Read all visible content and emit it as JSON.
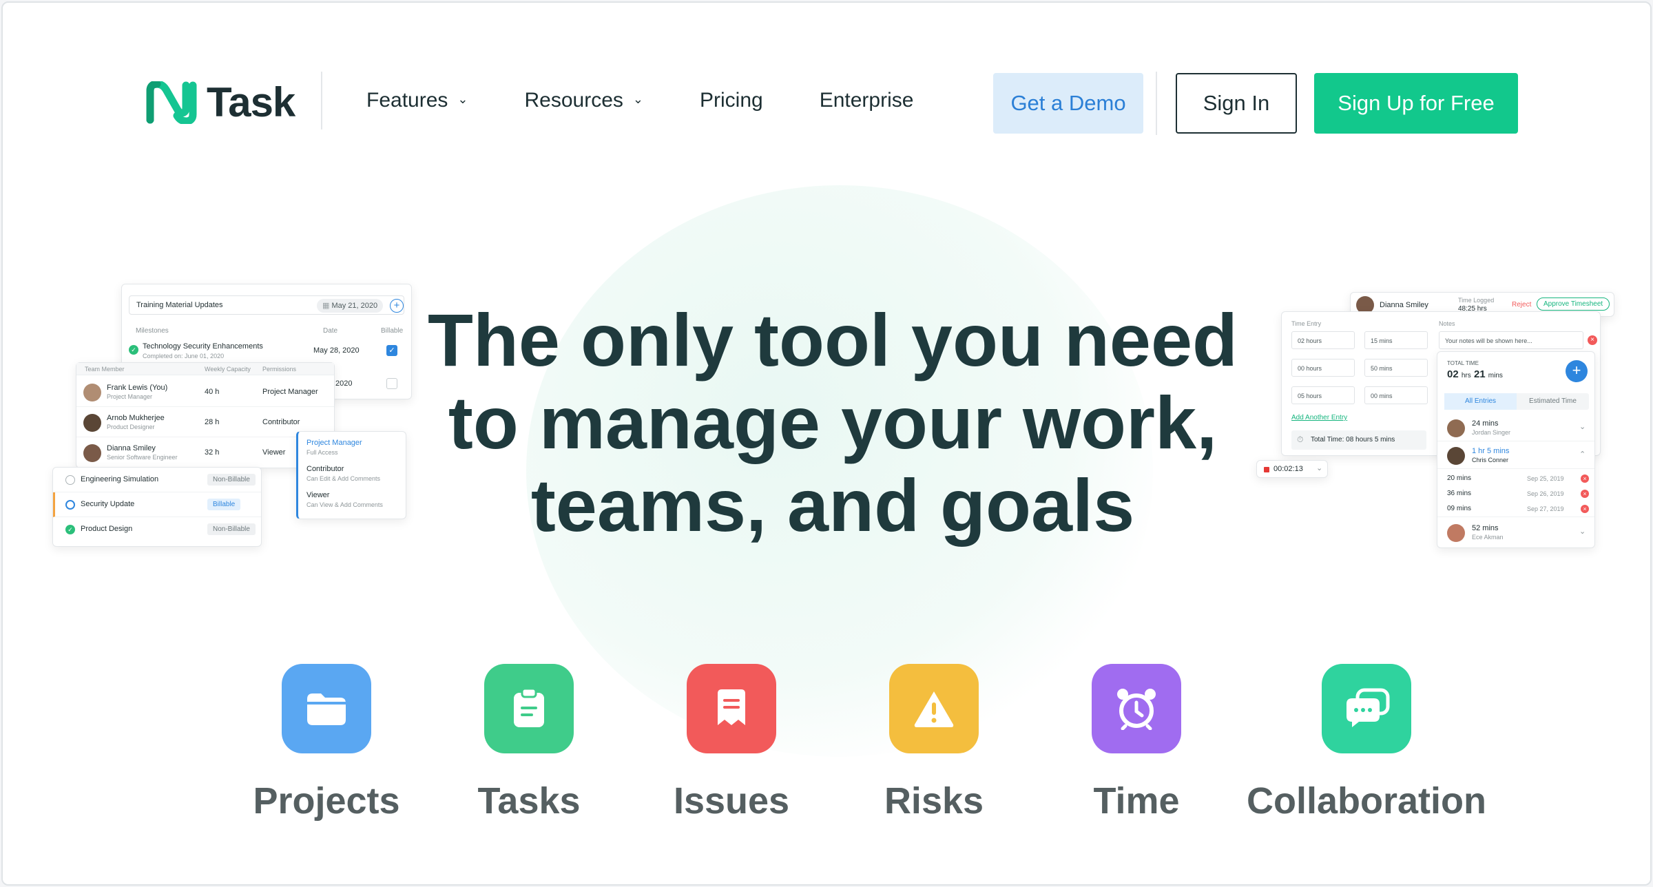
{
  "nav": {
    "logo_text": "Task",
    "items": [
      {
        "label": "Features",
        "has_dropdown": true
      },
      {
        "label": "Resources",
        "has_dropdown": true
      },
      {
        "label": "Pricing",
        "has_dropdown": false
      },
      {
        "label": "Enterprise",
        "has_dropdown": false
      }
    ],
    "demo_label": "Get a Demo",
    "signin_label": "Sign In",
    "signup_label": "Sign Up for Free"
  },
  "hero": {
    "line1": "The only tool you need",
    "line2": "to manage your work,",
    "line3": "teams, and goals"
  },
  "features": [
    {
      "label": "Projects",
      "color": "#5aa7f2",
      "icon": "folder-icon"
    },
    {
      "label": "Tasks",
      "color": "#3fcc8a",
      "icon": "clipboard-icon"
    },
    {
      "label": "Issues",
      "color": "#f25a5a",
      "icon": "issue-icon"
    },
    {
      "label": "Risks",
      "color": "#f4be3e",
      "icon": "warning-icon"
    },
    {
      "label": "Time",
      "color": "#a06cf0",
      "icon": "alarm-clock-icon"
    },
    {
      "label": "Collaboration",
      "color": "#2fd39e",
      "icon": "chat-icon"
    }
  ],
  "left_mockup": {
    "milestone_input": "Training Material Updates",
    "milestone_date": "May 21, 2020",
    "col_milestones": "Milestones",
    "col_date": "Date",
    "col_billable": "Billable",
    "milestone_row_title": "Technology Security Enhancements",
    "milestone_row_sub": "Completed on: June 01, 2020",
    "milestone_row_date": "May 28, 2020",
    "milestone_row2_date": "2020",
    "team_header": {
      "member": "Team Member",
      "capacity": "Weekly Capacity",
      "permissions": "Permissions"
    },
    "team": [
      {
        "name": "Frank Lewis (You)",
        "role": "Project Manager",
        "hours": "40 h",
        "permission": "Project Manager"
      },
      {
        "name": "Arnob Mukherjee",
        "role": "Product Designer",
        "hours": "28 h",
        "permission": "Contributor"
      },
      {
        "name": "Dianna Smiley",
        "role": "Senior Software Engineer",
        "hours": "32 h",
        "permission": "Viewer"
      }
    ],
    "perm_menu": [
      {
        "title": "Project Manager",
        "desc": "Full Access"
      },
      {
        "title": "Contributor",
        "desc": "Can Edit & Add Comments"
      },
      {
        "title": "Viewer",
        "desc": "Can View & Add Comments"
      }
    ],
    "tasks": [
      {
        "name": "Engineering Simulation",
        "tag": "Non-Billable"
      },
      {
        "name": "Security Update",
        "tag": "Billable"
      },
      {
        "name": "Product Design",
        "tag": "Non-Billable"
      }
    ]
  },
  "right_mockup": {
    "user_name": "Dianna Smiley",
    "time_logged_label": "Time Logged",
    "time_logged_value": "48:25 hrs",
    "reject_label": "Reject",
    "approve_label": "Approve Timesheet",
    "time_entry_label": "Time Entry",
    "notes_label": "Notes",
    "entries": [
      {
        "hours": "02 hours",
        "mins": "15 mins"
      },
      {
        "hours": "00 hours",
        "mins": "50 mins"
      },
      {
        "hours": "05 hours",
        "mins": "00 mins"
      }
    ],
    "notes_placeholder": "Your notes will be shown here...",
    "add_entry": "Add Another Entry",
    "total_time_text": "Total Time: 08 hours 5 mins",
    "timer": "00:02:13",
    "total_time_label": "TOTAL TIME",
    "total_hrs": "02",
    "total_hrs_unit": "hrs",
    "total_mins": "21",
    "total_mins_unit": "mins",
    "tab_all": "All Entries",
    "tab_est": "Estimated Time",
    "people": [
      {
        "mins": "24 mins",
        "name": "Jordan Singer"
      },
      {
        "mins": "1 hr 5 mins",
        "name": "Chris Conner"
      }
    ],
    "log_rows": [
      {
        "mins": "20 mins",
        "date": "Sep 25, 2019"
      },
      {
        "mins": "36 mins",
        "date": "Sep 26, 2019"
      },
      {
        "mins": "09 mins",
        "date": "Sep 27, 2019"
      }
    ],
    "last_person": {
      "mins": "52 mins",
      "name": "Ece Akman"
    }
  }
}
